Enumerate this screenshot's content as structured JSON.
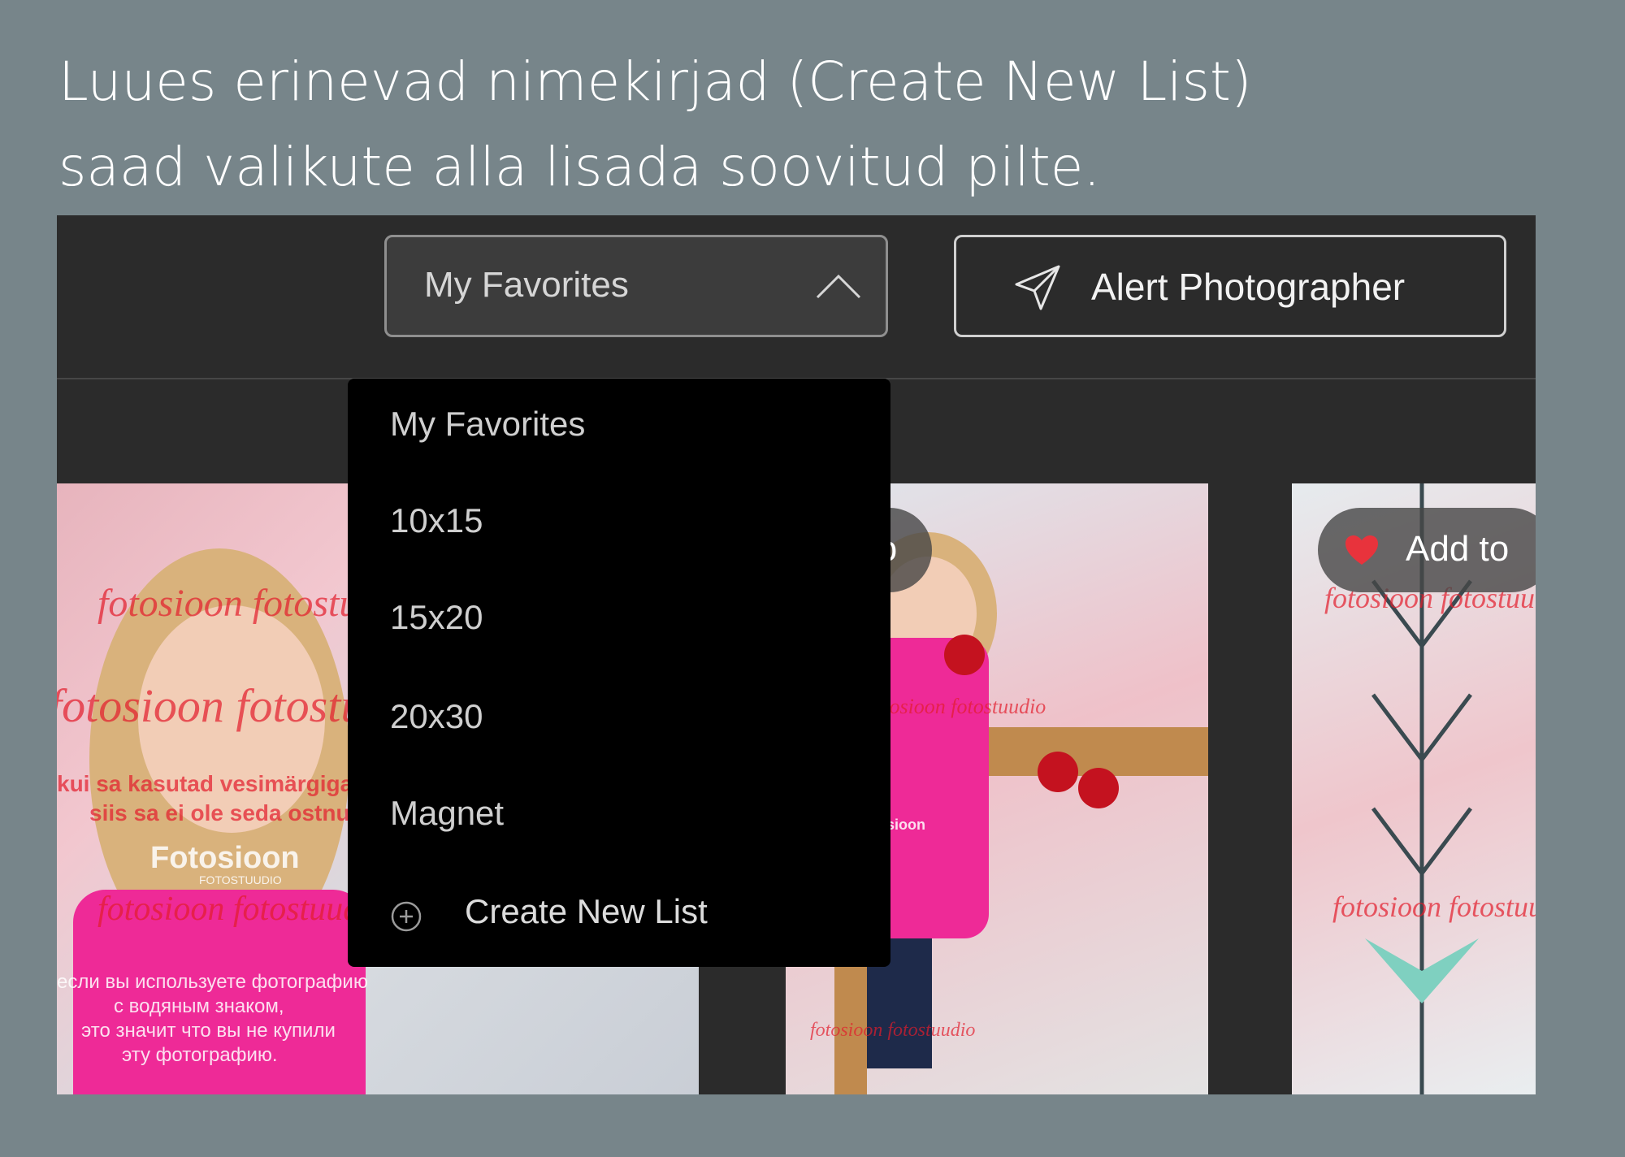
{
  "caption": {
    "line1": "Luues erinevad nimekirjad (Create New List)",
    "line2": "saad valikute alla lisada soovitud pilte."
  },
  "toolbar": {
    "list_select_value": "My Favorites",
    "alert_button_label": "Alert Photographer"
  },
  "dropdown": {
    "items": [
      "My Favorites",
      "10x15",
      "15x20",
      "20x30",
      "Magnet"
    ],
    "create_label": "Create New List"
  },
  "gallery": {
    "add_to_label": "Add to",
    "watermark_script": "fotosioon fotostuudio",
    "watermark_et": [
      "kui sa kasutad vesimärgiga",
      "siis sa ei ole seda ostnud"
    ],
    "watermark_ru": [
      "если вы используете фотографию",
      "с водяным знаком,",
      "это значит что вы не купили",
      "эту фотографию."
    ],
    "logo": "Fotosioon",
    "logo_sub": "FOTOSTUUDIO"
  },
  "colors": {
    "page_bg": "#77858a",
    "panel_bg": "#2b2b2b",
    "dropdown_bg": "#000000",
    "heart": "#e8333c"
  }
}
